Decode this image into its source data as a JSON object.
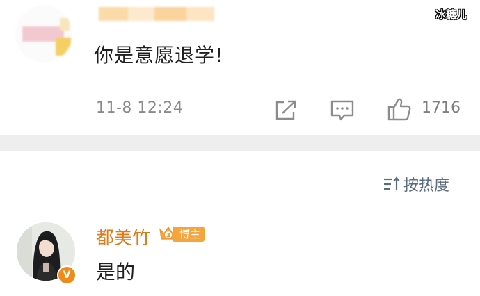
{
  "top_comment": {
    "text": "你是意愿退学!",
    "timestamp": "11-8 12:24",
    "like_count": "1716",
    "icons": {
      "share": "share-icon",
      "reply": "comment-icon",
      "like": "thumbs-up-icon"
    }
  },
  "sort": {
    "label": "按热度",
    "icon": "sort-icon"
  },
  "reply_comment": {
    "author": "都美竹",
    "badge": "博主",
    "verified_mark": "V",
    "text": "是的"
  },
  "watermark": {
    "text": "冰糖儿"
  },
  "colors": {
    "author": "#e07a17",
    "badge_bg": "#f4a53b",
    "verified": "#f08a1a",
    "meta_gray": "#8a8a8a",
    "sort_text": "#5b6b80",
    "divider": "#eeeeee"
  }
}
